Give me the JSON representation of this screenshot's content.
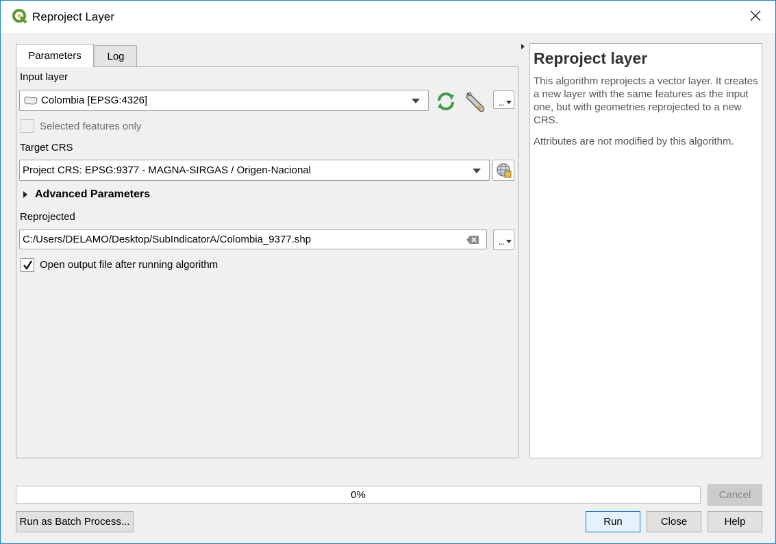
{
  "window": {
    "title": "Reproject Layer"
  },
  "tabs": [
    {
      "label": "Parameters",
      "active": true
    },
    {
      "label": "Log",
      "active": false
    }
  ],
  "params": {
    "input_layer_label": "Input layer",
    "input_layer_value": "Colombia [EPSG:4326]",
    "selected_features_label": "Selected features only",
    "selected_features_checked": false,
    "target_crs_label": "Target CRS",
    "target_crs_value": "Project CRS: EPSG:9377 - MAGNA-SIRGAS / Origen-Nacional",
    "advanced_label": "Advanced Parameters",
    "reprojected_label": "Reprojected",
    "reprojected_value": "C:/Users/DELAMO/Desktop/SubIndicatorA/Colombia_9377.shp",
    "open_output_label": "Open output file after running algorithm",
    "open_output_checked": true,
    "more_button": "..."
  },
  "help": {
    "title": "Reproject layer",
    "para1": "This algorithm reprojects a vector layer. It creates a new layer with the same features as the input one, but with geometries reprojected to a new CRS.",
    "para2": "Attributes are not modified by this algorithm."
  },
  "progress": {
    "value": 0,
    "text": "0%"
  },
  "buttons": {
    "cancel": "Cancel",
    "batch": "Run as Batch Process...",
    "run": "Run",
    "close": "Close",
    "help": "Help"
  },
  "colors": {
    "accent": "#0078d7",
    "qgis_green": "#589632",
    "qgis_yellow": "#eebf2a",
    "refresh_green": "#3f9b4a"
  }
}
